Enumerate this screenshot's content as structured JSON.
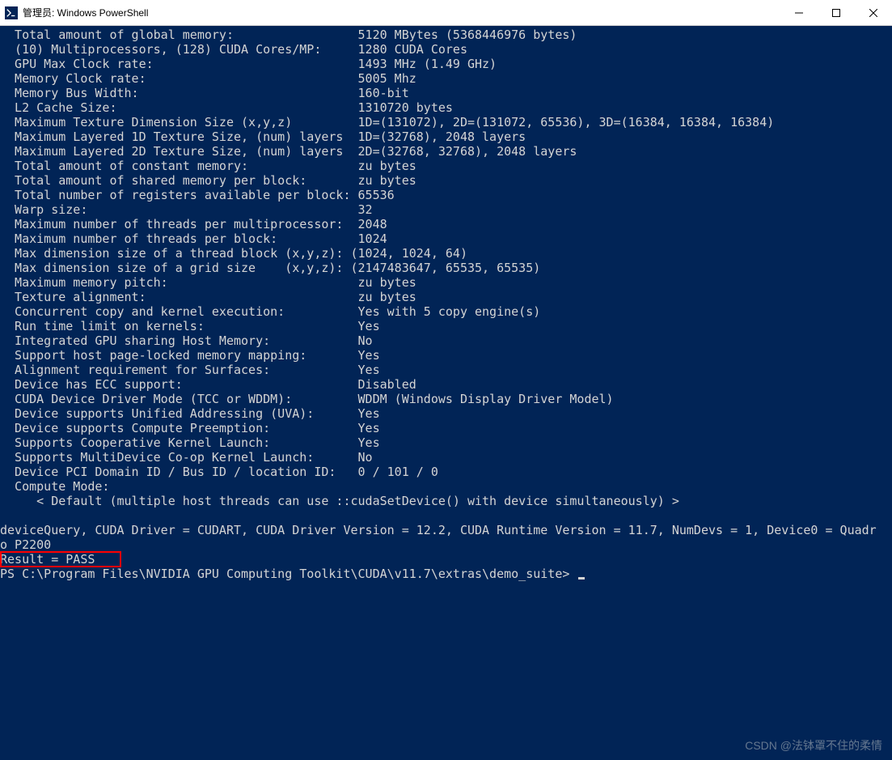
{
  "window": {
    "title": "管理员: Windows PowerShell"
  },
  "controls": {
    "minimize": "—",
    "maximize": "☐",
    "close": "✕"
  },
  "terminal": {
    "lines": [
      "  Total amount of global memory:                 5120 MBytes (5368446976 bytes)",
      "  (10) Multiprocessors, (128) CUDA Cores/MP:     1280 CUDA Cores",
      "  GPU Max Clock rate:                            1493 MHz (1.49 GHz)",
      "  Memory Clock rate:                             5005 Mhz",
      "  Memory Bus Width:                              160-bit",
      "  L2 Cache Size:                                 1310720 bytes",
      "  Maximum Texture Dimension Size (x,y,z)         1D=(131072), 2D=(131072, 65536), 3D=(16384, 16384, 16384)",
      "  Maximum Layered 1D Texture Size, (num) layers  1D=(32768), 2048 layers",
      "  Maximum Layered 2D Texture Size, (num) layers  2D=(32768, 32768), 2048 layers",
      "  Total amount of constant memory:               zu bytes",
      "  Total amount of shared memory per block:       zu bytes",
      "  Total number of registers available per block: 65536",
      "  Warp size:                                     32",
      "  Maximum number of threads per multiprocessor:  2048",
      "  Maximum number of threads per block:           1024",
      "  Max dimension size of a thread block (x,y,z): (1024, 1024, 64)",
      "  Max dimension size of a grid size    (x,y,z): (2147483647, 65535, 65535)",
      "  Maximum memory pitch:                          zu bytes",
      "  Texture alignment:                             zu bytes",
      "  Concurrent copy and kernel execution:          Yes with 5 copy engine(s)",
      "  Run time limit on kernels:                     Yes",
      "  Integrated GPU sharing Host Memory:            No",
      "  Support host page-locked memory mapping:       Yes",
      "  Alignment requirement for Surfaces:            Yes",
      "  Device has ECC support:                        Disabled",
      "  CUDA Device Driver Mode (TCC or WDDM):         WDDM (Windows Display Driver Model)",
      "  Device supports Unified Addressing (UVA):      Yes",
      "  Device supports Compute Preemption:            Yes",
      "  Supports Cooperative Kernel Launch:            Yes",
      "  Supports MultiDevice Co-op Kernel Launch:      No",
      "  Device PCI Domain ID / Bus ID / location ID:   0 / 101 / 0",
      "  Compute Mode:",
      "     < Default (multiple host threads can use ::cudaSetDevice() with device simultaneously) >",
      "",
      "deviceQuery, CUDA Driver = CUDART, CUDA Driver Version = 12.2, CUDA Runtime Version = 11.7, NumDevs = 1, Device0 = Quadr",
      "o P2200",
      "Result = PASS"
    ],
    "prompt": "PS C:\\Program Files\\NVIDIA GPU Computing Toolkit\\CUDA\\v11.7\\extras\\demo_suite> "
  },
  "watermark": "CSDN @法钵罩不住的柔情"
}
